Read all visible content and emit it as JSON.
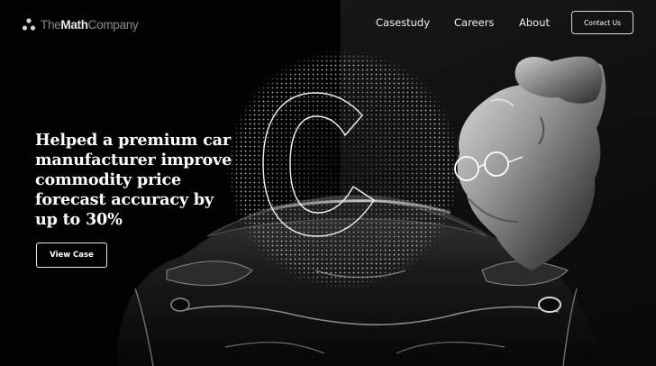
{
  "brand": {
    "name_part1": "The",
    "name_part2": "Math",
    "name_part3": "Company",
    "logo_icon": "three-dots-logo-icon"
  },
  "nav": {
    "items": [
      {
        "label": "Casestudy"
      },
      {
        "label": "Careers"
      },
      {
        "label": "About"
      }
    ],
    "contact_label": "Contact Us"
  },
  "hero": {
    "headline_lines": [
      "Helped a premium car",
      "manufacturer improve",
      "commodity price",
      "forecast accuracy by",
      "up to 30%"
    ],
    "cta_label": "View Case",
    "artwork": {
      "letter": "C",
      "elements": [
        "sports-car-front",
        "dotted-sphere",
        "statue-head-with-glasses"
      ]
    }
  },
  "colors": {
    "background_left": "#020202",
    "background_right": "#121212",
    "text": "#ffffff",
    "muted_text": "#8a8a8a"
  }
}
